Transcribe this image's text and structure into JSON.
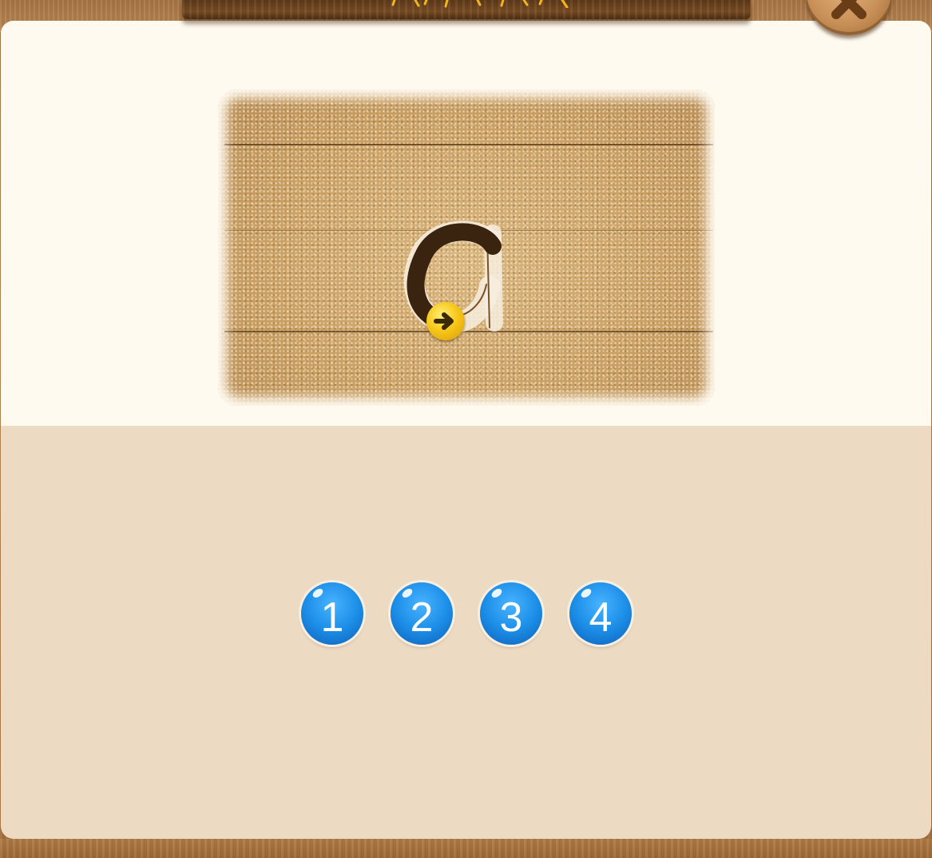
{
  "header": {
    "close_icon": "close-x-icon"
  },
  "tracing": {
    "letter": "a",
    "start_icon": "arrow-right-icon",
    "progress": 0.5
  },
  "levels": {
    "items": [
      {
        "label": "1"
      },
      {
        "label": "2"
      },
      {
        "label": "3"
      },
      {
        "label": "4"
      }
    ]
  },
  "colors": {
    "panel_top": "#fffaf0",
    "panel_bottom": "#eddac2",
    "trace_stroke": "#3a2410",
    "level_button": "#1d8fe8",
    "arrow_handle": "#f7c81a"
  }
}
